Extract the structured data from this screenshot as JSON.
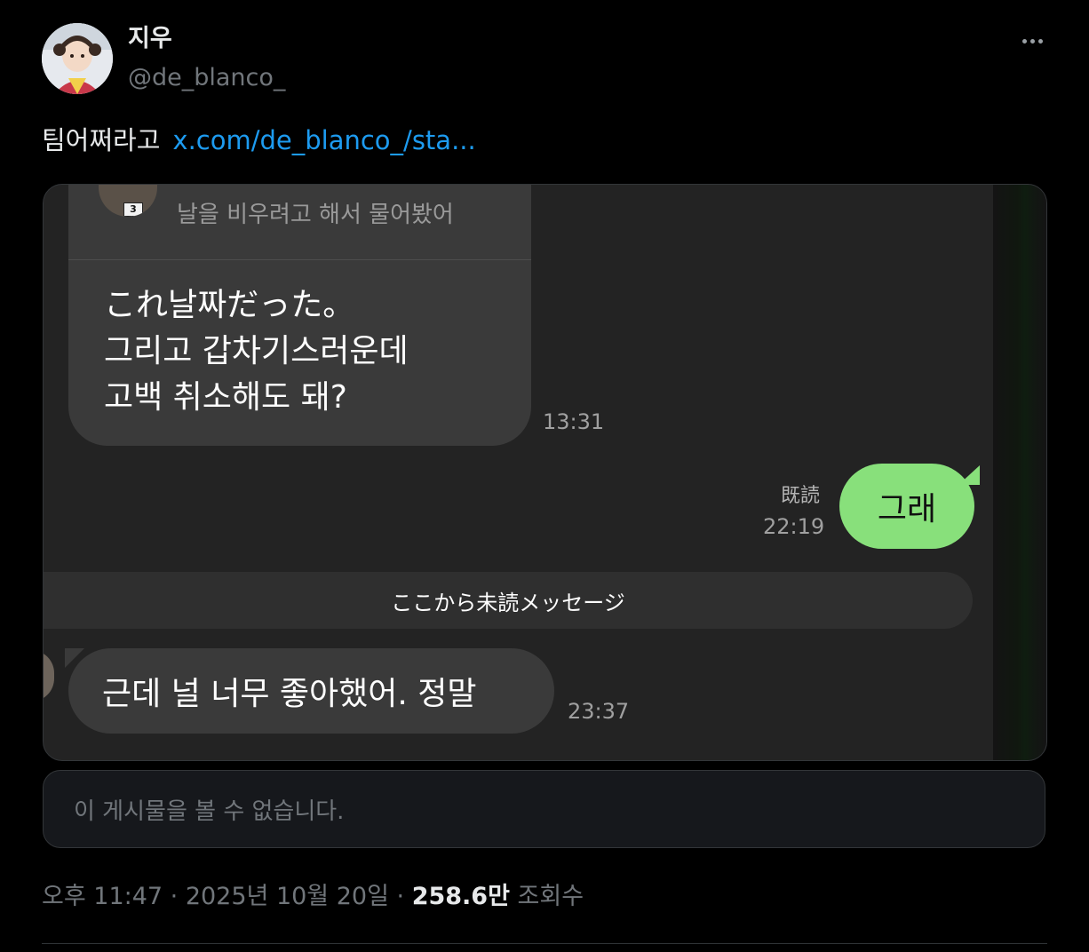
{
  "author": {
    "display_name": "지우",
    "handle": "@de_blanco_"
  },
  "tweet": {
    "text": "팀어쩌라고",
    "link": "x.com/de_blanco_/sta..."
  },
  "screenshot": {
    "quoted_preview": "날을 비우려고 해서 물어봤어",
    "quoted_badge": "3",
    "message_1_lines": [
      "これ날짜だった。",
      "그리고 갑차기스러운데",
      "고백 취소해도 돼?"
    ],
    "message_1_time": "13:31",
    "read_label": "既読",
    "reply_time": "22:19",
    "reply_text": "그래",
    "unread_divider": "ここから未読メッセージ",
    "message_2": "근데 널 너무 좋아했어. 정말",
    "message_2_time": "23:37"
  },
  "unavailable_quote": "이 게시물을 볼 수 없습니다.",
  "meta": {
    "timestamp": "오후 11:47 · 2025년 10월 20일 · ",
    "views_count": "258.6만",
    "views_label": " 조회수"
  },
  "colors": {
    "link": "#1d9bf0",
    "green_bubble": "#88e07b",
    "background": "#000000"
  }
}
